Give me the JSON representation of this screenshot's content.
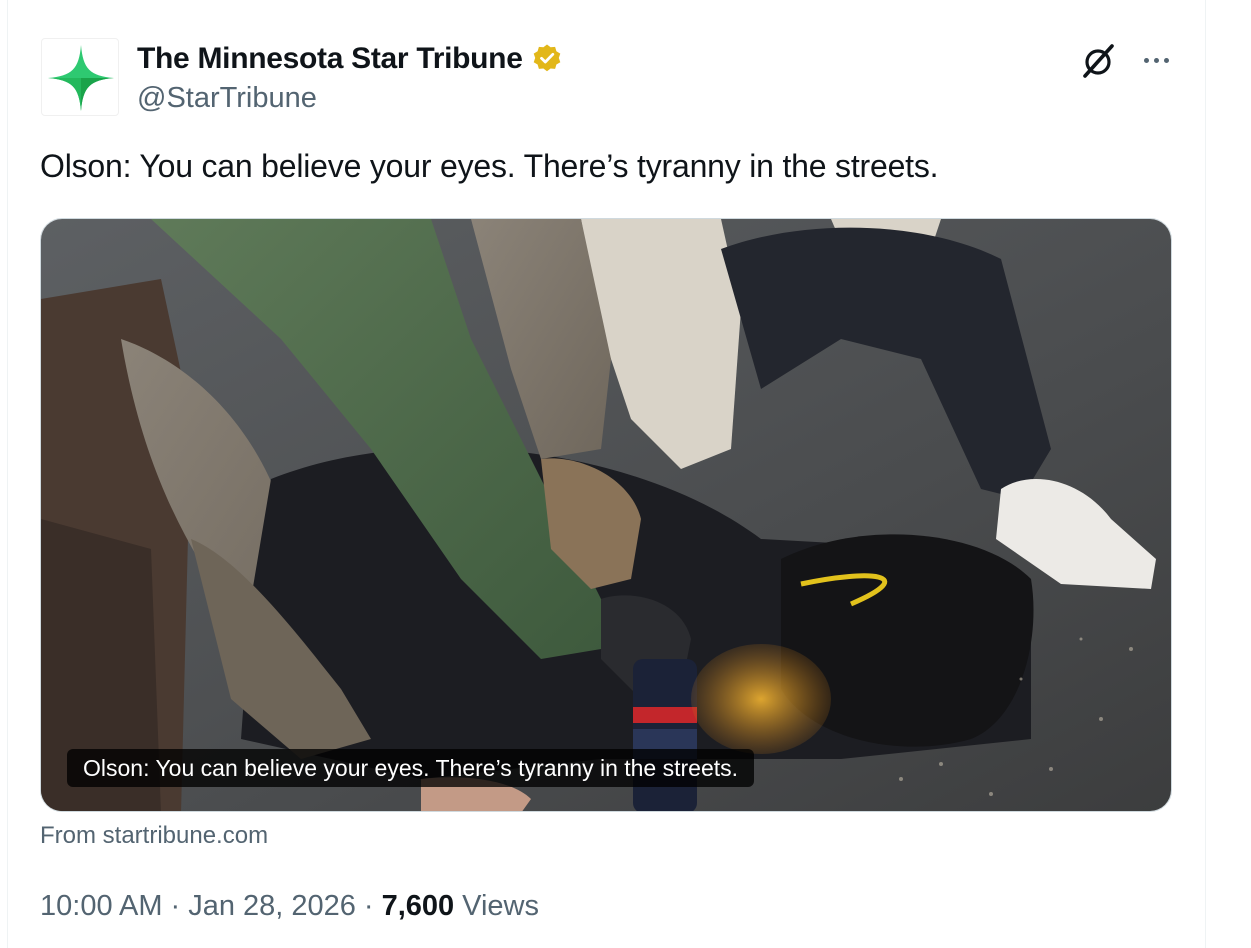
{
  "author": {
    "display_name": "The Minnesota Star Tribune",
    "handle": "@StarTribune",
    "verified_badge_color": "#e2b719",
    "avatar_icon": "star-tribune-logo-icon",
    "avatar_colors": [
      "#2ec971",
      "#1aa34a"
    ]
  },
  "actions": {
    "grok_icon": "grok-icon",
    "more_icon": "more-options-icon"
  },
  "tweet": {
    "text": "Olson: You can believe your eyes. There’s tyranny in the streets."
  },
  "card": {
    "caption": "Olson: You can believe your eyes. There’s tyranny in the streets.",
    "source": "From startribune.com"
  },
  "meta": {
    "time": "10:00 AM",
    "separator": "·",
    "date": "Jan 28, 2026",
    "views_count": "7,600",
    "views_label": "Views"
  },
  "colors": {
    "text_primary": "#0f1419",
    "text_secondary": "#536471",
    "border": "#cfd9de"
  }
}
